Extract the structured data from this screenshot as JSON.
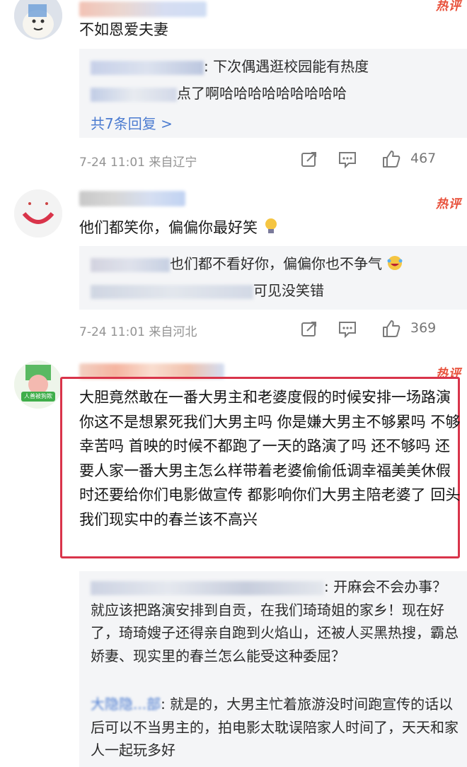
{
  "comments": [
    {
      "content": "不如恩爱夫妻",
      "replies": [
        {
          "text": ": 下次偶遇逛校园能有热度"
        },
        {
          "text": "点了啊哈哈哈哈哈哈哈哈哈"
        }
      ],
      "more_replies": "共7条回复 >",
      "meta": "7-24 11:01 来自辽宁",
      "likes": "467",
      "hot": "热评"
    },
    {
      "content": "他们都笑你，偏偏你最好笑",
      "replies": [
        {
          "text": "也们都不看好你，偏偏你也不争气"
        },
        {
          "text": "可见没笑错"
        }
      ],
      "meta": "7-24 11:01 来自河北",
      "likes": "369",
      "hot": "热评"
    },
    {
      "content": "大胆竟然敢在一番大男主和老婆度假的时候安排一场路演 你这不是想累死我们大男主吗 你是嫌大男主不够累吗 不够幸苦吗 首映的时候不都跑了一天的路演了吗 还不够吗 还要人家一番大男主怎么样带着老婆偷偷低调幸福美美休假时还要给你们电影做宣传 都影响你们大男主陪老婆了 回头我们现实中的春兰该不高兴",
      "hot": "热评",
      "avatar_caption": "人善被狗欺",
      "reply_1": ": 开麻会不会办事？就应该把路演安排到自贡，在我们琦琦姐的家乡！现在好了，琦琦嫂子还得亲自跑到火焰山，还被人买黑热搜，霸总娇妻、现实里的春兰怎么能受这种委屈？",
      "reply_2_name": "大隐隐...部",
      "reply_2": ": 就是的，大男主忙着旅游没时间跑宣传的话以后可以不当男主的，拍电影太耽误陪家人时间了，天天和家人一起玩多好"
    }
  ],
  "colors": {
    "hot": "#e8503a",
    "link": "#4b7bd0",
    "highlight_border": "#d9344a",
    "reply_bg": "#f4f5f7",
    "meta": "#939393"
  },
  "icons": [
    "share-icon",
    "comment-icon",
    "like-icon",
    "lightbulb-emoji",
    "laughing-crying-emoji"
  ]
}
